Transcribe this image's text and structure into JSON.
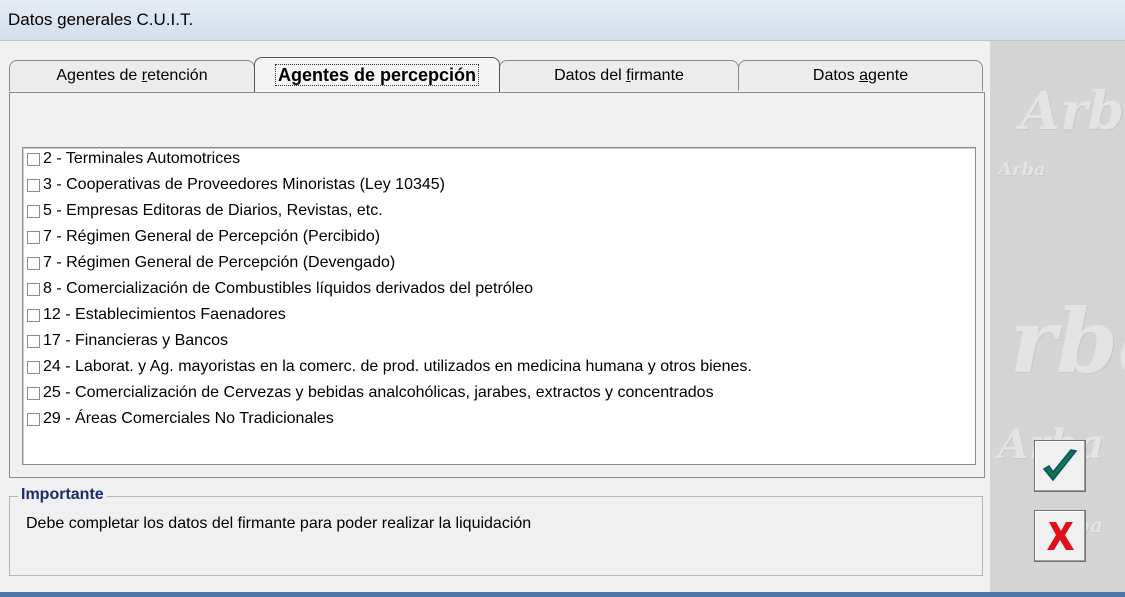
{
  "window": {
    "title": "Datos generales C.U.I.T."
  },
  "tabs": [
    {
      "label_pre": "Agentes de ",
      "label_u": "r",
      "label_post": "etención",
      "active": false
    },
    {
      "label_pre": "Agentes de percepción",
      "label_u": "",
      "label_post": "",
      "active": true
    },
    {
      "label_pre": "Datos del ",
      "label_u": "f",
      "label_post": "irmante",
      "active": false
    },
    {
      "label_pre": "Datos ",
      "label_u": "a",
      "label_post": "gente",
      "active": false
    }
  ],
  "agents": [
    {
      "label": "2 - Terminales Automotrices",
      "checked": false
    },
    {
      "label": "3 - Cooperativas de Proveedores Minoristas (Ley 10345)",
      "checked": false
    },
    {
      "label": "5 - Empresas Editoras de Diarios, Revistas, etc.",
      "checked": false
    },
    {
      "label": "7 - Régimen General de Percepción (Percibido)",
      "checked": false
    },
    {
      "label": "7 - Régimen General de Percepción (Devengado)",
      "checked": false
    },
    {
      "label": "8 - Comercialización de Combustibles líquidos derivados del petróleo",
      "checked": false
    },
    {
      "label": "12 - Establecimientos Faenadores",
      "checked": false
    },
    {
      "label": "17 - Financieras y Bancos",
      "checked": false
    },
    {
      "label": "24 - Laborat. y Ag. mayoristas en la comerc. de prod. utilizados en medicina humana y otros bienes.",
      "checked": false
    },
    {
      "label": "25 - Comercialización de Cervezas y bebidas analcohólicas, jarabes, extractos y concentrados",
      "checked": false
    },
    {
      "label": "29 - Áreas Comerciales No Tradicionales",
      "checked": false
    }
  ],
  "notice": {
    "title": "Importante",
    "message": "Debe completar los datos del firmante para poder realizar la liquidación"
  },
  "buttons": {
    "ok_icon": "checkmark-icon",
    "cancel_icon": "x-icon"
  },
  "colors": {
    "check": "#0f7a3c",
    "cancel": "#e0101a",
    "legend": "#1a2c6e"
  },
  "watermark": {
    "w1": "Arba",
    "w2": "Arba",
    "w3": "rba",
    "w4": "Arba",
    "w5": "Arba"
  }
}
